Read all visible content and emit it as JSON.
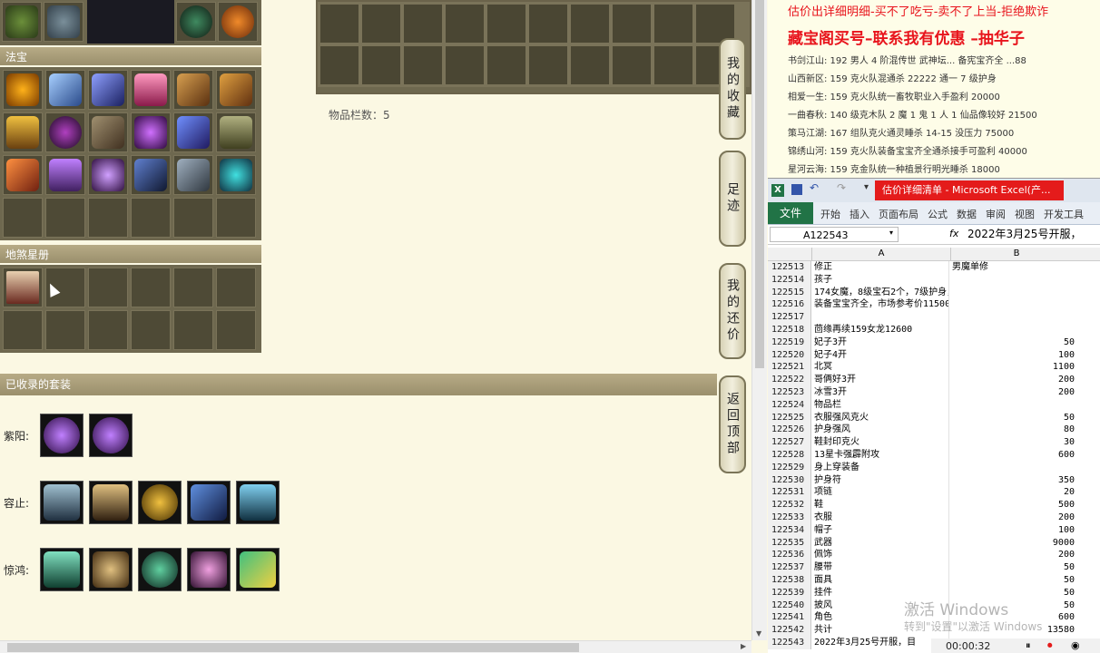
{
  "left_panel": {
    "fabao_header": "法宝",
    "dishaxingce_header": "地煞星册",
    "storage_count": "物品栏数：5",
    "collected_sets_header": "已收录的套装",
    "suits": [
      {
        "label": "紫阳:",
        "count": 2
      },
      {
        "label": "容止:",
        "count": 5
      },
      {
        "label": "惊鸿:",
        "count": 5
      }
    ],
    "side_tabs": [
      "我的收藏",
      "足迹",
      "我的还价",
      "返回顶部"
    ]
  },
  "ad": {
    "line1": "估价出详细明细-买不了吃亏-卖不了上当-拒绝欺诈",
    "title": "藏宝阁买号–联系我有优惠 –抽华子",
    "lines": [
      "书剑江山: 192 男人 4 阶混传世 武神坛... 备宪宝齐全 ...88",
      "山西新区: 159 克火队混通杀 22222 通一 7 级护身",
      "相爱一生: 159 克火队统一畜牧职业入手盈利 20000",
      "一曲春秋: 140 级克木队 2 魔 1 鬼 1 人 1 仙品像较好 21500",
      "策马江湖: 167 组队克火通灵睡杀 14-15 没压力 75000",
      "锦绣山河: 159 克火队装备宝宝齐全通杀接手可盈利 40000",
      "星河云海: 159 克金队统一种植景行明光睡杀 18000"
    ]
  },
  "excel": {
    "window_title": "估价详细清单 - Microsoft Excel(产...",
    "file_tab": "文件",
    "ribbon_tabs": [
      "开始",
      "插入",
      "页面布局",
      "公式",
      "数据",
      "审阅",
      "视图",
      "开发工具"
    ],
    "name_box": "A122543",
    "fx": "fx",
    "formula": "2022年3月25号开服，",
    "col_a": "A",
    "col_b": "B",
    "rows": [
      {
        "n": "122513",
        "a": "修正",
        "b": "男魔单修",
        "bl": true
      },
      {
        "n": "122514",
        "a": "孩子",
        "b": ""
      },
      {
        "n": "122515",
        "a": "174女魔，8级宝石2个，7级护身，克水抽一套",
        "b": ""
      },
      {
        "n": "122516",
        "a": "装备宝宝齐全，市场参考价11500左右",
        "b": ""
      },
      {
        "n": "122517",
        "a": "",
        "b": ""
      },
      {
        "n": "122518",
        "a": "茴缘再续159女龙12600",
        "b": ""
      },
      {
        "n": "122519",
        "a": "妃子3开",
        "b": "50"
      },
      {
        "n": "122520",
        "a": "妃子4开",
        "b": "100"
      },
      {
        "n": "122521",
        "a": "北冥",
        "b": "1100"
      },
      {
        "n": "122522",
        "a": "哥俩好3开",
        "b": "200"
      },
      {
        "n": "122523",
        "a": "冰雪3开",
        "b": "200"
      },
      {
        "n": "122524",
        "a": "物品栏",
        "b": ""
      },
      {
        "n": "122525",
        "a": "衣服强风克火",
        "b": "50"
      },
      {
        "n": "122526",
        "a": "护身强风",
        "b": "80"
      },
      {
        "n": "122527",
        "a": "鞋封印克火",
        "b": "30"
      },
      {
        "n": "122528",
        "a": "13星卡强霹附攻",
        "b": "600"
      },
      {
        "n": "122529",
        "a": "身上穿装备",
        "b": ""
      },
      {
        "n": "122530",
        "a": "护身符",
        "b": "350"
      },
      {
        "n": "122531",
        "a": "项链",
        "b": "20"
      },
      {
        "n": "122532",
        "a": "鞋",
        "b": "500"
      },
      {
        "n": "122533",
        "a": "衣服",
        "b": "200"
      },
      {
        "n": "122534",
        "a": "帽子",
        "b": "100"
      },
      {
        "n": "122535",
        "a": "武器",
        "b": "9000"
      },
      {
        "n": "122536",
        "a": "佩饰",
        "b": "200"
      },
      {
        "n": "122537",
        "a": "腰带",
        "b": "50"
      },
      {
        "n": "122538",
        "a": "面具",
        "b": "50"
      },
      {
        "n": "122539",
        "a": "挂件",
        "b": "50"
      },
      {
        "n": "122540",
        "a": "披风",
        "b": "50"
      },
      {
        "n": "122541",
        "a": "角色",
        "b": "600"
      },
      {
        "n": "122542",
        "a": "共计",
        "b": "13580"
      },
      {
        "n": "122543",
        "a": "2022年3月25号开服，目",
        "b": ""
      }
    ]
  },
  "overlay": {
    "watermark1": "激活 Windows",
    "watermark2": "转到\"设置\"以激活 Windows",
    "timer": "00:00:32"
  },
  "colors": {
    "ad_red": "#e8141c",
    "excel_green": "#217346",
    "panel_brown": "#8a8266"
  }
}
